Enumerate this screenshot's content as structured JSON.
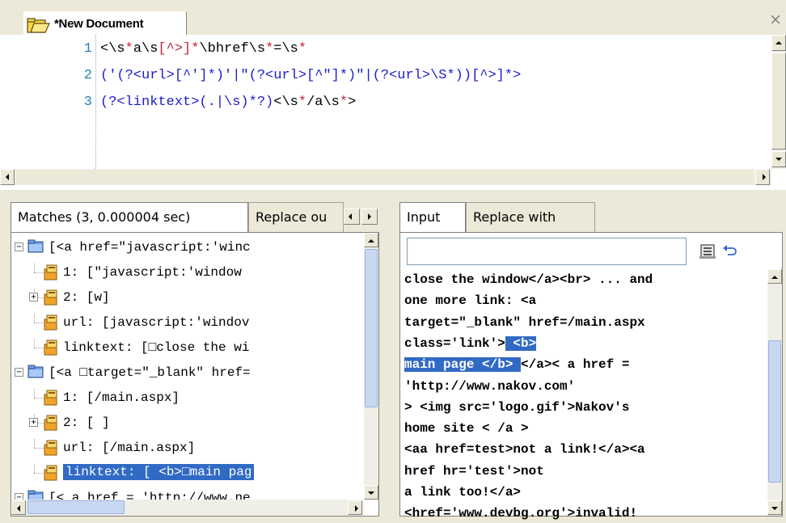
{
  "document": {
    "title": "*New Document",
    "close_glyph": "×"
  },
  "editor": {
    "lines": [
      {
        "num": "1",
        "segments": [
          {
            "t": "<\\s",
            "c": "e"
          },
          {
            "t": "*",
            "c": "r"
          },
          {
            "t": "a\\s",
            "c": "e"
          },
          {
            "t": "[^>]",
            "c": "r"
          },
          {
            "t": "*",
            "c": "r"
          },
          {
            "t": "\\bhref\\s",
            "c": "e"
          },
          {
            "t": "*",
            "c": "r"
          },
          {
            "t": "=\\s",
            "c": "e"
          },
          {
            "t": "*",
            "c": "r"
          }
        ]
      },
      {
        "num": "2",
        "segments": [
          {
            "t": "('(?<url>[^']*)'|\"(?<url>[^\"]*)\"|(?<url>\\S*))[^>]*>",
            "c": "b"
          }
        ]
      },
      {
        "num": "3",
        "segments": [
          {
            "t": "(?<linktext>(.|\\s)*?)",
            "c": "b"
          },
          {
            "t": "<\\s",
            "c": "e"
          },
          {
            "t": "*",
            "c": "r"
          },
          {
            "t": "/a\\s",
            "c": "e"
          },
          {
            "t": "*",
            "c": "r"
          },
          {
            "t": ">",
            "c": "e"
          }
        ]
      }
    ]
  },
  "left_tabs": {
    "matches_label": "Matches (3, 0.000004 sec)",
    "replace_label": "Replace ou"
  },
  "right_tabs": {
    "input_label": "Input",
    "replace_with_label": "Replace with"
  },
  "tree": [
    {
      "level": 0,
      "expander": "−",
      "icon": "folder",
      "text": "[<a href=\"javascript:'winc"
    },
    {
      "level": 1,
      "expander": "",
      "icon": "group",
      "text": "1: [\"javascript:'window"
    },
    {
      "level": 1,
      "expander": "+",
      "icon": "group",
      "text": "2: [w]"
    },
    {
      "level": 1,
      "expander": "",
      "icon": "group",
      "text": "url: [javascript:'windov"
    },
    {
      "level": 1,
      "expander": "",
      "icon": "group",
      "text": "linktext: [□close the wi"
    },
    {
      "level": 0,
      "expander": "−",
      "icon": "folder",
      "text": "[<a □target=\"_blank\" href="
    },
    {
      "level": 1,
      "expander": "",
      "icon": "group",
      "text": "1: [/main.aspx]"
    },
    {
      "level": 1,
      "expander": "+",
      "icon": "group",
      "text": "2: [ ]"
    },
    {
      "level": 1,
      "expander": "",
      "icon": "group",
      "text": "url: [/main.aspx]"
    },
    {
      "level": 1,
      "expander": "",
      "icon": "group",
      "text": "linktext: [ <b>□main pag",
      "selected": true
    },
    {
      "level": 0,
      "expander": "−",
      "icon": "folder",
      "text": "[< a href = 'http://www.ne"
    }
  ],
  "input_field": {
    "value": ""
  },
  "input_lines": [
    {
      "pre": "close the window</a><br> ... and",
      "hl": "",
      "post": ""
    },
    {
      "pre": "one more link: <a",
      "hl": "",
      "post": ""
    },
    {
      "pre": "target=\"_blank\" href=/main.aspx",
      "hl": "",
      "post": ""
    },
    {
      "pre": "class='link'>",
      "hl": " <b>",
      "post": ""
    },
    {
      "pre": "",
      "hl": "main page </b> ",
      "post": "</a>< a href ="
    },
    {
      "pre": "'http://www.nakov.com'",
      "hl": "",
      "post": ""
    },
    {
      "pre": "> <img src='logo.gif'>Nakov's",
      "hl": "",
      "post": ""
    },
    {
      "pre": "home site < /a >",
      "hl": "",
      "post": ""
    },
    {
      "pre": "<aa href=test>not a link!</a><a",
      "hl": "",
      "post": ""
    },
    {
      "pre": "href hr='test'>not",
      "hl": "",
      "post": ""
    },
    {
      "pre": "a link too!</a>",
      "hl": "",
      "post": ""
    },
    {
      "pre": "<href='www.devbg.org'>invalid!",
      "hl": "",
      "post": ""
    }
  ],
  "icons": {
    "doc_tab": "folder-document-icon",
    "toolbar_a": "clipboard-icon",
    "toolbar_b": "undo-icon"
  },
  "colors": {
    "selection": "#316AC5",
    "regex_quantifier": "#C0283C",
    "regex_group": "#1C1CCC",
    "line_number": "#2A7FB0"
  }
}
